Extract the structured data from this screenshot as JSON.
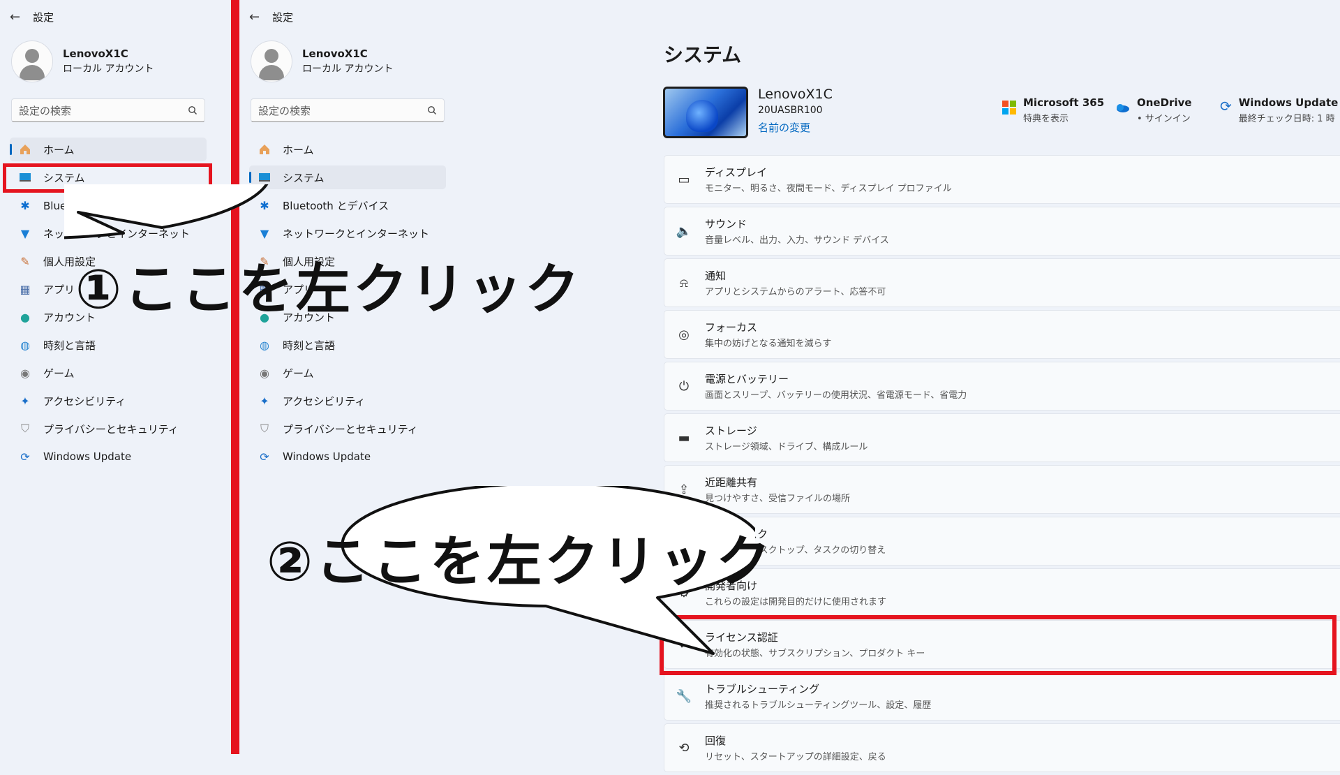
{
  "app_title": "設定",
  "back_glyph": "←",
  "profile": {
    "name": "LenovoX1C",
    "account": "ローカル アカウント"
  },
  "search": {
    "placeholder": "設定の検索",
    "icon": "search-icon"
  },
  "nav_items": [
    {
      "label": "ホーム",
      "icon": "home-icon"
    },
    {
      "label": "システム",
      "icon": "system-display-icon"
    },
    {
      "label": "Bluetooth とデバイス",
      "icon": "bluetooth-icon"
    },
    {
      "label": "ネットワークとインターネット",
      "icon": "wifi-icon"
    },
    {
      "label": "個人用設定",
      "icon": "brush-icon"
    },
    {
      "label": "アプリ",
      "icon": "apps-icon"
    },
    {
      "label": "アカウント",
      "icon": "account-icon"
    },
    {
      "label": "時刻と言語",
      "icon": "globe-clock-icon"
    },
    {
      "label": "ゲーム",
      "icon": "gamepad-icon"
    },
    {
      "label": "アクセシビリティ",
      "icon": "accessibility-icon"
    },
    {
      "label": "プライバシーとセキュリティ",
      "icon": "shield-icon"
    },
    {
      "label": "Windows Update",
      "icon": "update-icon"
    }
  ],
  "main": {
    "title": "システム",
    "device": {
      "name": "LenovoX1C",
      "model": "20UASBR100",
      "rename": "名前の変更"
    },
    "status": [
      {
        "name": "Microsoft 365",
        "sub": "特典を表示",
        "icon": "microsoft-logo-icon"
      },
      {
        "name": "OneDrive",
        "sub": "• サインイン",
        "icon": "onedrive-cloud-icon"
      },
      {
        "name": "Windows Update",
        "sub": "最終チェック日時: 1 時",
        "icon": "update-icon"
      }
    ],
    "rows": [
      {
        "title": "ディスプレイ",
        "sub": "モニター、明るさ、夜間モード、ディスプレイ プロファイル",
        "icon": "monitor-icon"
      },
      {
        "title": "サウンド",
        "sub": "音量レベル、出力、入力、サウンド デバイス",
        "icon": "speaker-icon"
      },
      {
        "title": "通知",
        "sub": "アプリとシステムからのアラート、応答不可",
        "icon": "bell-icon"
      },
      {
        "title": "フォーカス",
        "sub": "集中の妨げとなる通知を減らす",
        "icon": "focus-icon"
      },
      {
        "title": "電源とバッテリー",
        "sub": "画面とスリープ、バッテリーの使用状況、省電源モード、省電力",
        "icon": "power-icon"
      },
      {
        "title": "ストレージ",
        "sub": "ストレージ領域、ドライブ、構成ルール",
        "icon": "storage-icon"
      },
      {
        "title": "近距離共有",
        "sub": "見つけやすさ、受信ファイルの場所",
        "icon": "share-icon"
      },
      {
        "title": "マルチタスク",
        "sub": "スナップ、デスクトップ、タスクの切り替え",
        "icon": "multitask-icon"
      },
      {
        "title": "開発者向け",
        "sub": "これらの設定は開発目的だけに使用されます",
        "icon": "developer-icon"
      },
      {
        "title": "ライセンス認証",
        "sub": "有効化の状態、サブスクリプション、プロダクト キー",
        "icon": "check-circle-icon"
      },
      {
        "title": "トラブルシューティング",
        "sub": "推奨されるトラブルシューティングツール、設定、履歴",
        "icon": "wrench-icon"
      },
      {
        "title": "回復",
        "sub": "リセット、スタートアップの詳細設定、戻る",
        "icon": "recovery-icon"
      }
    ]
  },
  "callouts": [
    "①ここを左クリック",
    "②ここを左クリック"
  ],
  "colors": {
    "highlight": "#e5141f",
    "accent": "#0067c0",
    "background": "#eef2f9"
  }
}
